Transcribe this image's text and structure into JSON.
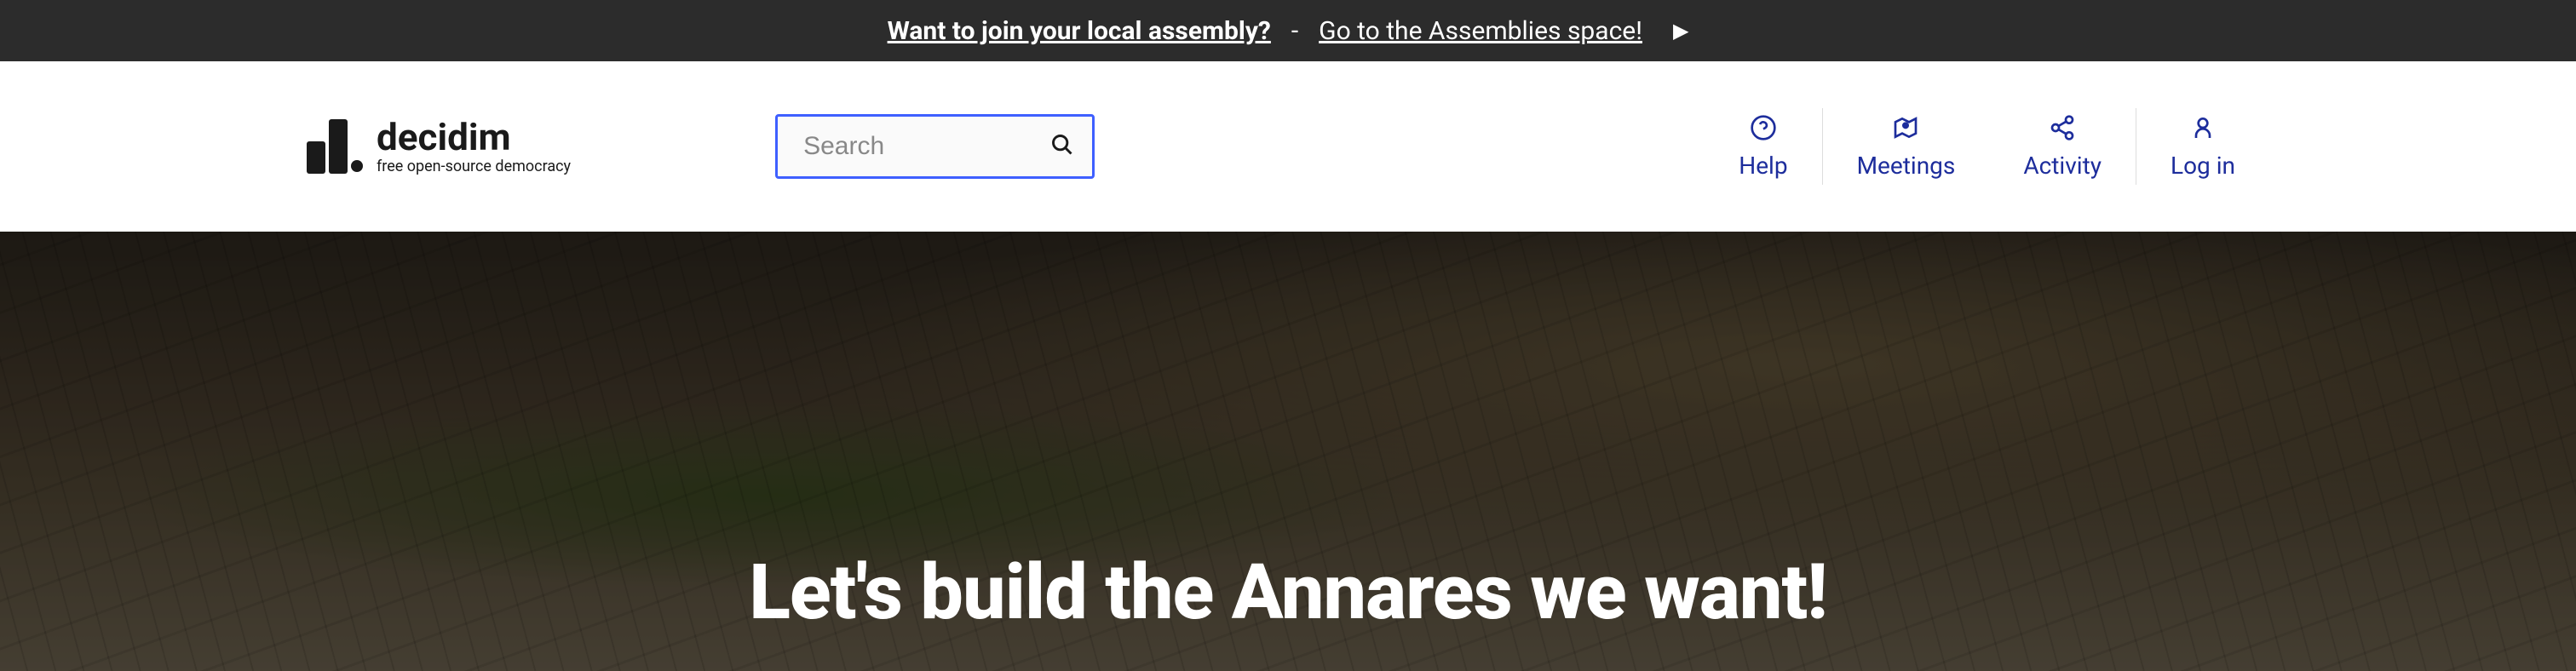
{
  "announcement": {
    "question": "Want to join your local assembly?",
    "divider": "-",
    "link_text": "Go to the Assemblies space!",
    "arrow": "▶"
  },
  "logo": {
    "name": "decidim",
    "tagline": "free open-source democracy"
  },
  "search": {
    "placeholder": "Search"
  },
  "nav": {
    "help": "Help",
    "meetings": "Meetings",
    "activity": "Activity",
    "login": "Log in"
  },
  "hero": {
    "title": "Let's build the Annares we want!"
  },
  "colors": {
    "primary": "#1d2d9c",
    "search_border": "#3e5fff",
    "dark_bar": "#2c2c2c"
  }
}
